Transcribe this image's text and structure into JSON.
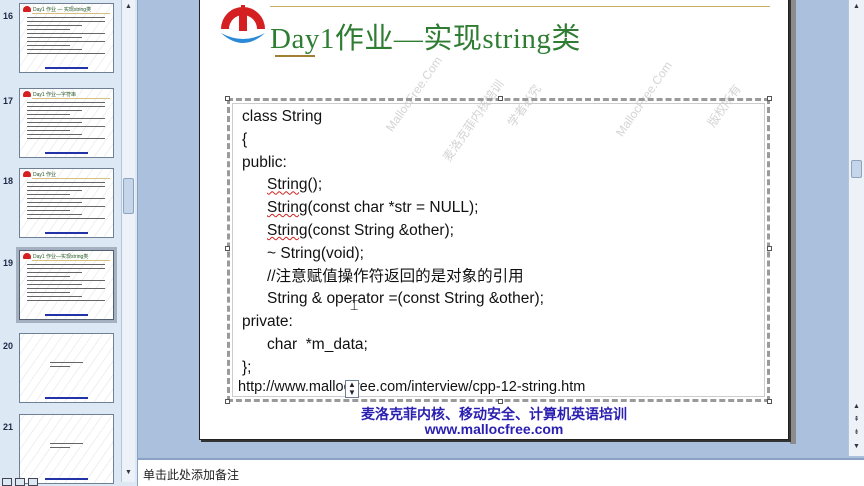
{
  "thumbnails": [
    {
      "number": "16",
      "title": "Day1 作业 — 实现string类"
    },
    {
      "number": "17",
      "title": "Day1 作业—字符串"
    },
    {
      "number": "18",
      "title": "Day1 作业"
    },
    {
      "number": "19",
      "title": "Day1 作业—实现string类",
      "selected": true
    },
    {
      "number": "20",
      "title": ""
    },
    {
      "number": "21",
      "title": ""
    }
  ],
  "slide": {
    "title": "Day1作业—实现string类",
    "code_lines": [
      {
        "text": "class String",
        "indent": false
      },
      {
        "text": "{",
        "indent": false
      },
      {
        "text": "public:",
        "indent": false
      },
      {
        "text": "String();",
        "indent": true
      },
      {
        "text": "String(const char *str = NULL);",
        "indent": true
      },
      {
        "text": "String(const String &other);",
        "indent": true
      },
      {
        "text": "~ String(void);",
        "indent": true
      },
      {
        "text": "//注意赋值操作符返回的是对象的引用",
        "indent": true
      },
      {
        "text": "String & operator =(const String &other);",
        "indent": true
      },
      {
        "text": "private:",
        "indent": false
      },
      {
        "text": "char  *m_data;",
        "indent": true
      },
      {
        "text": "};",
        "indent": false
      }
    ],
    "url": "http://www.mallocfree.com/interview/cpp-12-string.htm",
    "footer_line1": "麦洛克菲内核、移动安全、计算机英语培训",
    "footer_line2": "www.mallocfree.com",
    "watermarks": [
      "MallocFree.Com",
      "麦洛克菲内核培训",
      "学者必究",
      "MallocFree.Com",
      "版权所有"
    ]
  },
  "notes": {
    "placeholder": "单击此处添加备注"
  },
  "colors": {
    "title_green": "#2e7d32",
    "footer_blue": "#2a1fb0",
    "logo_red": "#d42020",
    "logo_blue": "#2a8ad8"
  }
}
